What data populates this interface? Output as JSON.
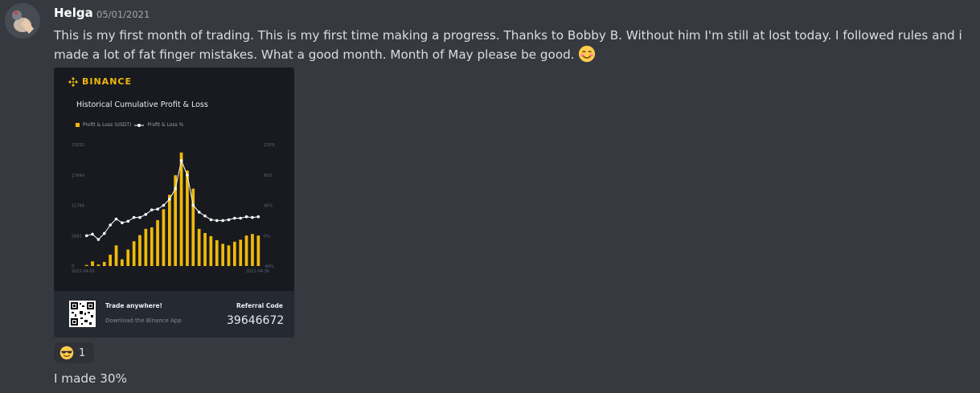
{
  "message": {
    "username": "Helga",
    "timestamp": "05/01/2021",
    "text": "This is my first month of trading. This is my first time making a progress. Thanks to Bobby B. Without him I'm still at lost today. I followed rules and i made a lot of fat finger mistakes. What a good month. Month of May please be good.",
    "emoji": "smiling-face-with-smiling-eyes-icon",
    "avatar": "avatar"
  },
  "embed": {
    "brand": "BINANCE",
    "chart_title": "Historical Cumulative Profit & Loss",
    "legend_bar": "Profit & Loss (USDT)",
    "legend_line": "Profit & Loss %",
    "footer": {
      "trade_title": "Trade anywhere!",
      "trade_sub": "Download the Binance App",
      "ref_label": "Referral Code",
      "ref_code": "39646672"
    }
  },
  "chart_data": {
    "type": "bar",
    "title": "Historical Cumulative Profit & Loss",
    "series": [
      {
        "name": "Profit & Loss (USDT)",
        "type": "bar",
        "color": "#f0b90b",
        "values": [
          200,
          900,
          300,
          800,
          2200,
          4000,
          1300,
          3200,
          4800,
          6000,
          7200,
          7500,
          8900,
          11000,
          13800,
          17600,
          22000,
          18500,
          15000,
          7200,
          6400,
          5800,
          5000,
          4300,
          4000,
          4700,
          5100,
          5900,
          6200,
          5900
        ]
      },
      {
        "name": "Profit & Loss %",
        "type": "line",
        "color": "#ffffff",
        "values": [
          0,
          2,
          -5,
          3,
          14,
          22,
          17,
          19,
          24,
          24,
          28,
          34,
          35,
          40,
          48,
          62,
          99,
          80,
          40,
          31,
          26,
          21,
          20,
          20,
          21,
          23,
          23,
          25,
          24,
          25
        ]
      }
    ],
    "x_start": "2021-04-01",
    "x_end": "2021-04-30",
    "y_left_ticks": [
      "0",
      "5883",
      "11766",
      "17649",
      "23532"
    ],
    "y_right_ticks": [
      "-40%",
      "0%",
      "40%",
      "80%",
      "120%"
    ],
    "y_left_range": [
      0,
      23532
    ],
    "y_right_range": [
      -40,
      120
    ]
  },
  "reaction": {
    "emoji": "smiling-face-with-sunglasses-icon",
    "count": "1"
  },
  "message2": {
    "text": "I made 30%"
  }
}
